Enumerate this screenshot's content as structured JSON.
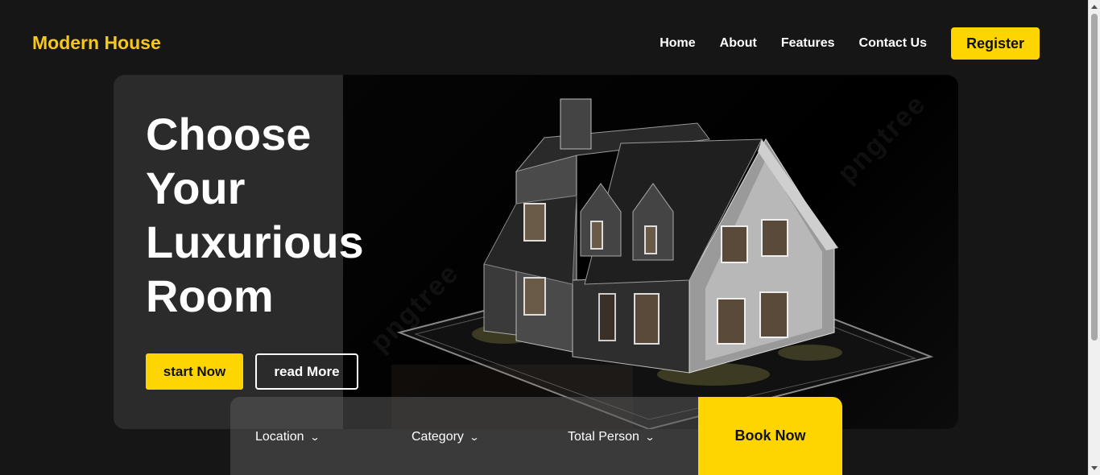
{
  "brand": {
    "name": "Modern House",
    "color": "#f7c81a"
  },
  "nav": {
    "items": [
      "Home",
      "About",
      "Features",
      "Contact Us"
    ],
    "register_label": "Register"
  },
  "hero": {
    "headline_lines": [
      "Choose",
      "Your",
      "Luxurious",
      "Room"
    ],
    "start_label": "start Now",
    "read_label": "read More",
    "image": "house-model-illustration"
  },
  "booking": {
    "location_label": "Location",
    "category_label": "Category",
    "persons_label": "Total Person",
    "book_label": "Book Now"
  },
  "colors": {
    "accent": "#ffd500",
    "background": "#161616",
    "card": "#2b2b2b"
  }
}
